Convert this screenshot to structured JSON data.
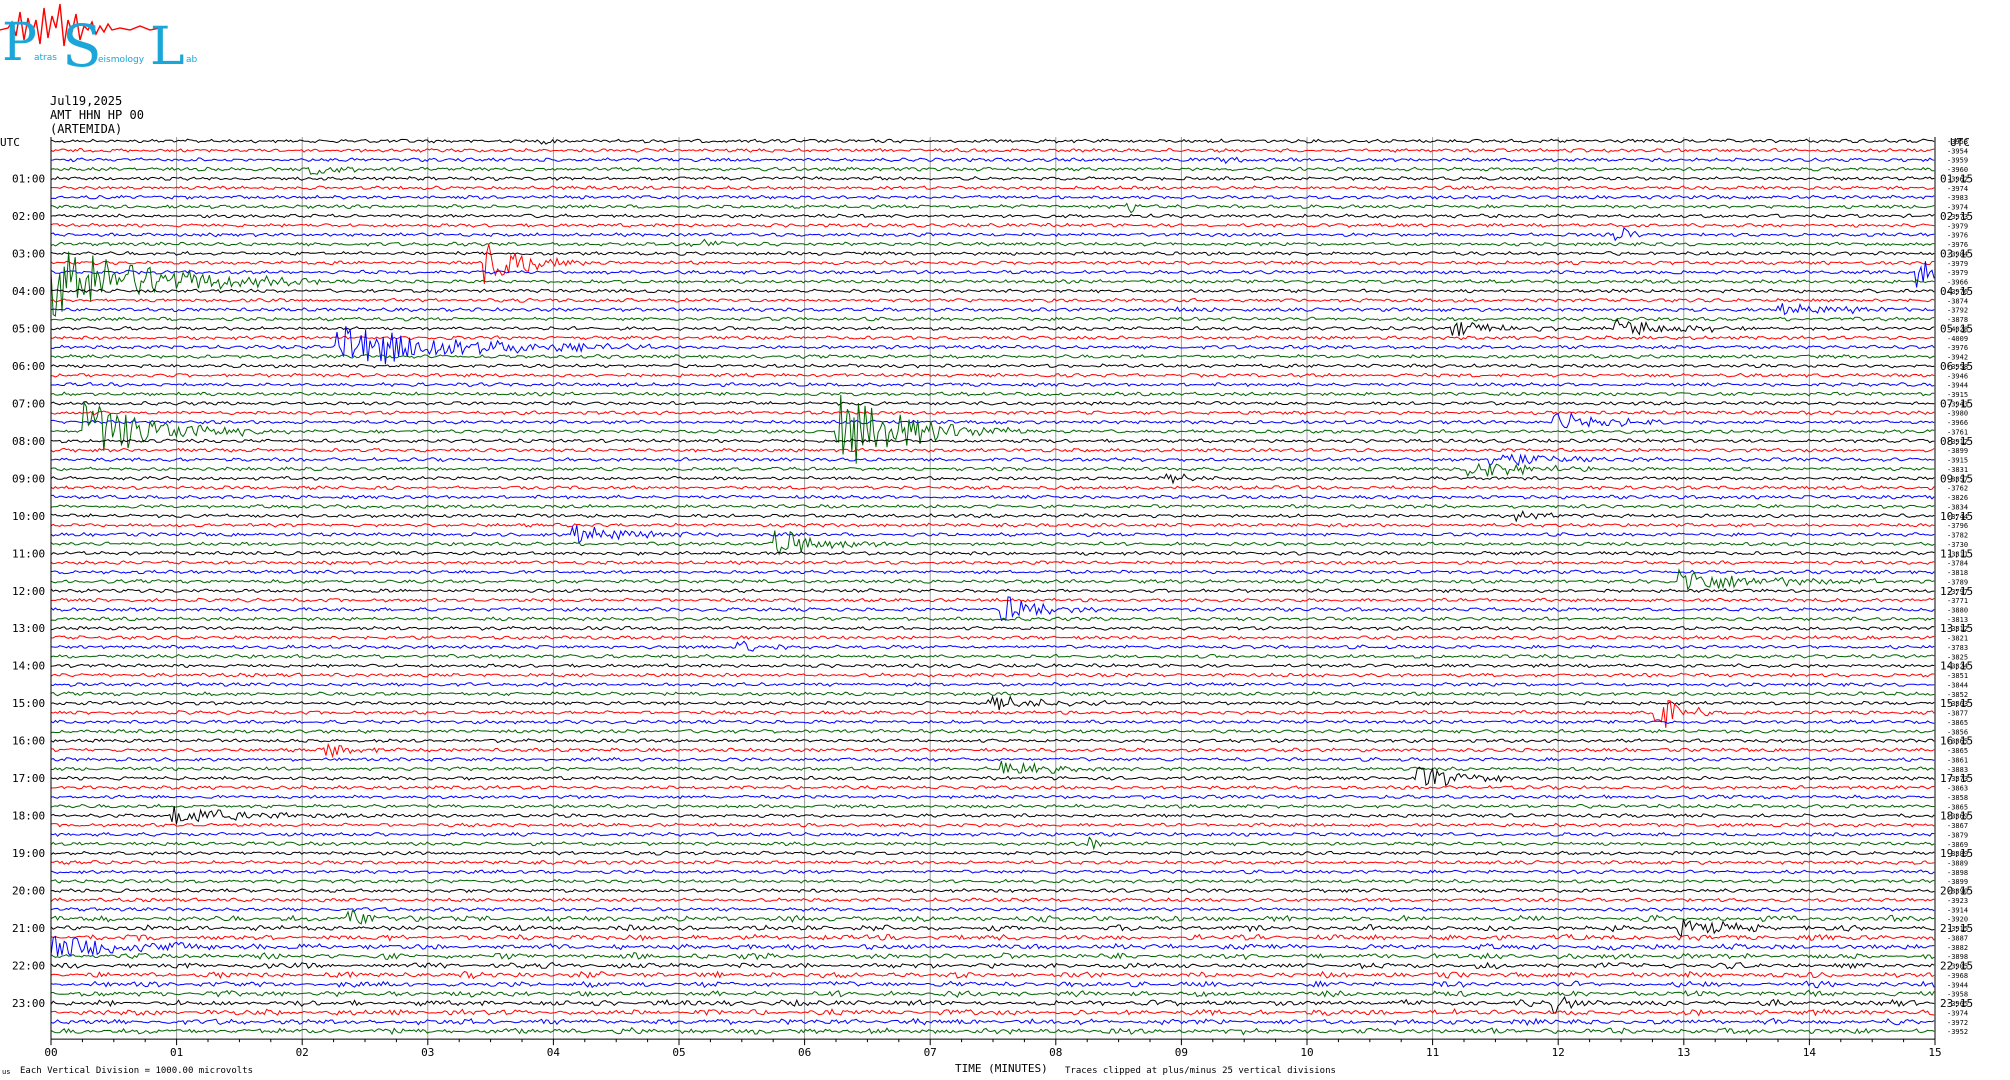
{
  "logo": {
    "letters": [
      "P",
      "S",
      "L"
    ],
    "words": [
      "atras",
      "eismology",
      "ab"
    ]
  },
  "header": {
    "date": "Jul19,2025",
    "station": "AMT HHN HP 00",
    "site": "(ARTEMIDA)"
  },
  "footer": {
    "scale_note": "Each Vertical Division = 1000.00 microvolts",
    "clip_note": "Traces clipped at plus/minus 25 vertical divisions",
    "corner_mark": "us"
  },
  "chart_data": {
    "type": "line",
    "title": "",
    "xlabel": "TIME (MINUTES)",
    "ylabel": "UTC",
    "right_axis_label": "UTC",
    "xlim": [
      0,
      15
    ],
    "x_ticks": [
      "00",
      "01",
      "02",
      "03",
      "04",
      "05",
      "06",
      "07",
      "08",
      "09",
      "10",
      "11",
      "12",
      "13",
      "14",
      "15"
    ],
    "left_hour_labels": [
      "01:00",
      "02:00",
      "03:00",
      "04:00",
      "05:00",
      "06:00",
      "07:00",
      "08:00",
      "09:00",
      "10:00",
      "11:00",
      "12:00",
      "13:00",
      "14:00",
      "15:00",
      "16:00",
      "17:00",
      "18:00",
      "19:00",
      "20:00",
      "21:00",
      "22:00",
      "23:00"
    ],
    "right_hour_labels": [
      "01:15",
      "02:15",
      "03:15",
      "04:15",
      "05:15",
      "06:15",
      "07:15",
      "08:15",
      "09:15",
      "10:15",
      "11:15",
      "12:15",
      "13:15",
      "14:15",
      "15:15",
      "16:15",
      "17:15",
      "18:15",
      "19:15",
      "20:15",
      "21:15",
      "22:15",
      "23:15"
    ],
    "trace_color_cycle": [
      "#000000",
      "#ff0000",
      "#0000ff",
      "#006400"
    ],
    "trace_count": 96,
    "minutes_per_trace": 15,
    "grid": true,
    "trace_means": [
      -3953,
      -3954,
      -3959,
      -3960,
      -3962,
      -3974,
      -3983,
      -3974,
      -3973,
      -3979,
      -3976,
      -3976,
      -3984,
      -3979,
      -3979,
      -3966,
      -3976,
      -3874,
      -3792,
      -3878,
      -4028,
      -4009,
      -3976,
      -3942,
      -3958,
      -3946,
      -3944,
      -3915,
      -3943,
      -3980,
      -3966,
      -3761,
      -3912,
      -3899,
      -3915,
      -3831,
      -3857,
      -3762,
      -3826,
      -3834,
      -3744,
      -3796,
      -3782,
      -3730,
      -3811,
      -3784,
      -3818,
      -3789,
      -3797,
      -3771,
      -3880,
      -3813,
      -3812,
      -3821,
      -3783,
      -3825,
      -3824,
      -3851,
      -3844,
      -3852,
      -3863,
      -3877,
      -3865,
      -3856,
      -3865,
      -3865,
      -3861,
      -3883,
      -3873,
      -3863,
      -3858,
      -3865,
      -3869,
      -3867,
      -3879,
      -3869,
      -3889,
      -3889,
      -3898,
      -3899,
      -3890,
      -3923,
      -3914,
      -3920,
      -3915,
      -3887,
      -3882,
      -3898,
      -3905,
      -3968,
      -3944,
      -3958,
      -3965,
      -3974,
      -3972,
      -3952
    ],
    "events": [
      {
        "trace": 0,
        "minute": 3.95,
        "amp": 3,
        "dur": 0.3
      },
      {
        "trace": 2,
        "minute": 9.3,
        "amp": 3,
        "dur": 0.6
      },
      {
        "trace": 3,
        "minute": 2.1,
        "amp": 6,
        "dur": 0.8
      },
      {
        "trace": 7,
        "minute": 8.6,
        "amp": 6,
        "dur": 0.2
      },
      {
        "trace": 10,
        "minute": 12.5,
        "amp": 8,
        "dur": 0.3
      },
      {
        "trace": 11,
        "minute": 5.1,
        "amp": 5,
        "dur": 0.9
      },
      {
        "trace": 13,
        "minute": 3.5,
        "amp": 25,
        "dur": 0.8
      },
      {
        "trace": 15,
        "minute": 0.0,
        "amp": 40,
        "dur": 2.2
      },
      {
        "trace": 14,
        "minute": 14.9,
        "amp": 20,
        "dur": 0.3
      },
      {
        "trace": 18,
        "minute": 9.0,
        "amp": 3,
        "dur": 0.6
      },
      {
        "trace": 18,
        "minute": 13.8,
        "amp": 6,
        "dur": 1.5
      },
      {
        "trace": 20,
        "minute": 11.2,
        "amp": 8,
        "dur": 1.0
      },
      {
        "trace": 20,
        "minute": 12.5,
        "amp": 9,
        "dur": 1.6
      },
      {
        "trace": 22,
        "minute": 2.3,
        "amp": 25,
        "dur": 2.5
      },
      {
        "trace": 31,
        "minute": 0.3,
        "amp": 30,
        "dur": 1.6
      },
      {
        "trace": 31,
        "minute": 6.3,
        "amp": 40,
        "dur": 1.5
      },
      {
        "trace": 30,
        "minute": 12.0,
        "amp": 9,
        "dur": 1.4
      },
      {
        "trace": 34,
        "minute": 11.5,
        "amp": 8,
        "dur": 1.6
      },
      {
        "trace": 35,
        "minute": 11.3,
        "amp": 10,
        "dur": 1.2
      },
      {
        "trace": 36,
        "minute": 8.9,
        "amp": 4,
        "dur": 0.8
      },
      {
        "trace": 40,
        "minute": 11.7,
        "amp": 6,
        "dur": 0.6
      },
      {
        "trace": 42,
        "minute": 4.2,
        "amp": 10,
        "dur": 1.2
      },
      {
        "trace": 43,
        "minute": 5.8,
        "amp": 14,
        "dur": 1.0
      },
      {
        "trace": 47,
        "minute": 13.0,
        "amp": 12,
        "dur": 1.8
      },
      {
        "trace": 50,
        "minute": 7.6,
        "amp": 16,
        "dur": 0.8
      },
      {
        "trace": 54,
        "minute": 5.5,
        "amp": 6,
        "dur": 0.8
      },
      {
        "trace": 60,
        "minute": 7.5,
        "amp": 7,
        "dur": 1.4
      },
      {
        "trace": 61,
        "minute": 12.8,
        "amp": 22,
        "dur": 0.5
      },
      {
        "trace": 65,
        "minute": 2.2,
        "amp": 8,
        "dur": 0.8
      },
      {
        "trace": 67,
        "minute": 7.6,
        "amp": 10,
        "dur": 0.9
      },
      {
        "trace": 68,
        "minute": 10.9,
        "amp": 12,
        "dur": 1.0
      },
      {
        "trace": 72,
        "minute": 1.0,
        "amp": 10,
        "dur": 1.6
      },
      {
        "trace": 75,
        "minute": 8.3,
        "amp": 6,
        "dur": 0.2
      },
      {
        "trace": 83,
        "minute": 2.4,
        "amp": 9,
        "dur": 0.8
      },
      {
        "trace": 84,
        "minute": 13.0,
        "amp": 8,
        "dur": 1.2
      },
      {
        "trace": 86,
        "minute": 0.0,
        "amp": 14,
        "dur": 1.8
      },
      {
        "trace": 92,
        "minute": 12.0,
        "amp": 10,
        "dur": 0.4
      }
    ]
  }
}
